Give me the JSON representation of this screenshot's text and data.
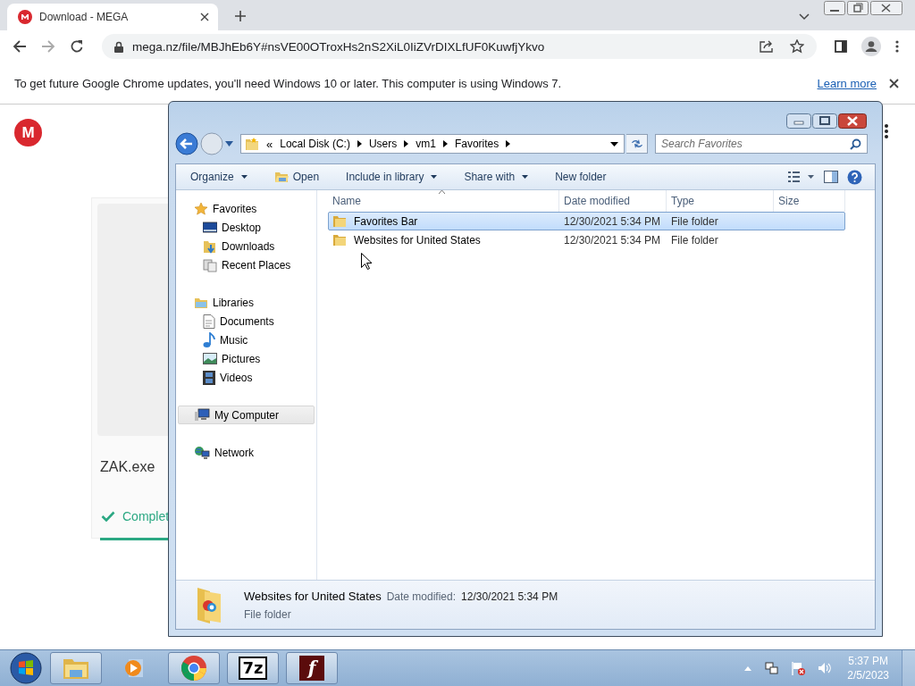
{
  "browser": {
    "tab": {
      "title": "Download - MEGA"
    },
    "url": "mega.nz/file/MBJhEb6Y#nsVE00OTroxHs2nS2XiL0IiZVrDIXLfUF0KuwfjYkvo",
    "infobar": {
      "message": "To get future Google Chrome updates, you'll need Windows 10 or later. This computer is using Windows 7.",
      "link": "Learn more"
    }
  },
  "page": {
    "logo": "M",
    "file_name": "ZAK.exe",
    "status": "Complet"
  },
  "explorer": {
    "overflow": "«",
    "breadcrumb": [
      "Local Disk (C:)",
      "Users",
      "vm1",
      "Favorites"
    ],
    "search_placeholder": "Search Favorites",
    "toolbar": [
      {
        "label": "Organize",
        "dropdown": true,
        "icon": false
      },
      {
        "label": "Open",
        "dropdown": false,
        "icon": true
      },
      {
        "label": "Include in library",
        "dropdown": true,
        "icon": false
      },
      {
        "label": "Share with",
        "dropdown": true,
        "icon": false
      },
      {
        "label": "New folder",
        "dropdown": false,
        "icon": false
      }
    ],
    "columns": [
      "Name",
      "Date modified",
      "Type",
      "Size"
    ],
    "nav": [
      {
        "label": "Favorites",
        "selected": false,
        "children": [
          {
            "label": "Desktop",
            "selected": false
          },
          {
            "label": "Downloads",
            "selected": false
          },
          {
            "label": "Recent Places",
            "selected": false
          }
        ]
      },
      {
        "label": "Libraries",
        "selected": false,
        "children": [
          {
            "label": "Documents",
            "selected": false
          },
          {
            "label": "Music",
            "selected": false
          },
          {
            "label": "Pictures",
            "selected": false
          },
          {
            "label": "Videos",
            "selected": false
          }
        ]
      },
      {
        "label": "My Computer",
        "selected": true
      },
      {
        "label": "Network",
        "selected": false
      }
    ],
    "files": [
      {
        "name": "Favorites Bar",
        "date": "12/30/2021 5:34 PM",
        "type": "File folder",
        "selected": true
      },
      {
        "name": "Websites for United States",
        "date": "12/30/2021 5:34 PM",
        "type": "File folder",
        "selected": false
      }
    ],
    "details": {
      "name": "Websites for United States",
      "date_label": "Date modified:",
      "date": "12/30/2021 5:34 PM",
      "type": "File folder"
    }
  },
  "taskbar": {
    "apps": [
      {
        "kind": "folder",
        "running": true
      },
      {
        "kind": "media",
        "running": false
      },
      {
        "kind": "chrome",
        "running": true
      },
      {
        "kind": "text",
        "label": "7z",
        "running": true
      },
      {
        "kind": "flash",
        "label": "f",
        "running": true
      }
    ],
    "time": "5:37 PM",
    "date": "2/5/2023"
  }
}
